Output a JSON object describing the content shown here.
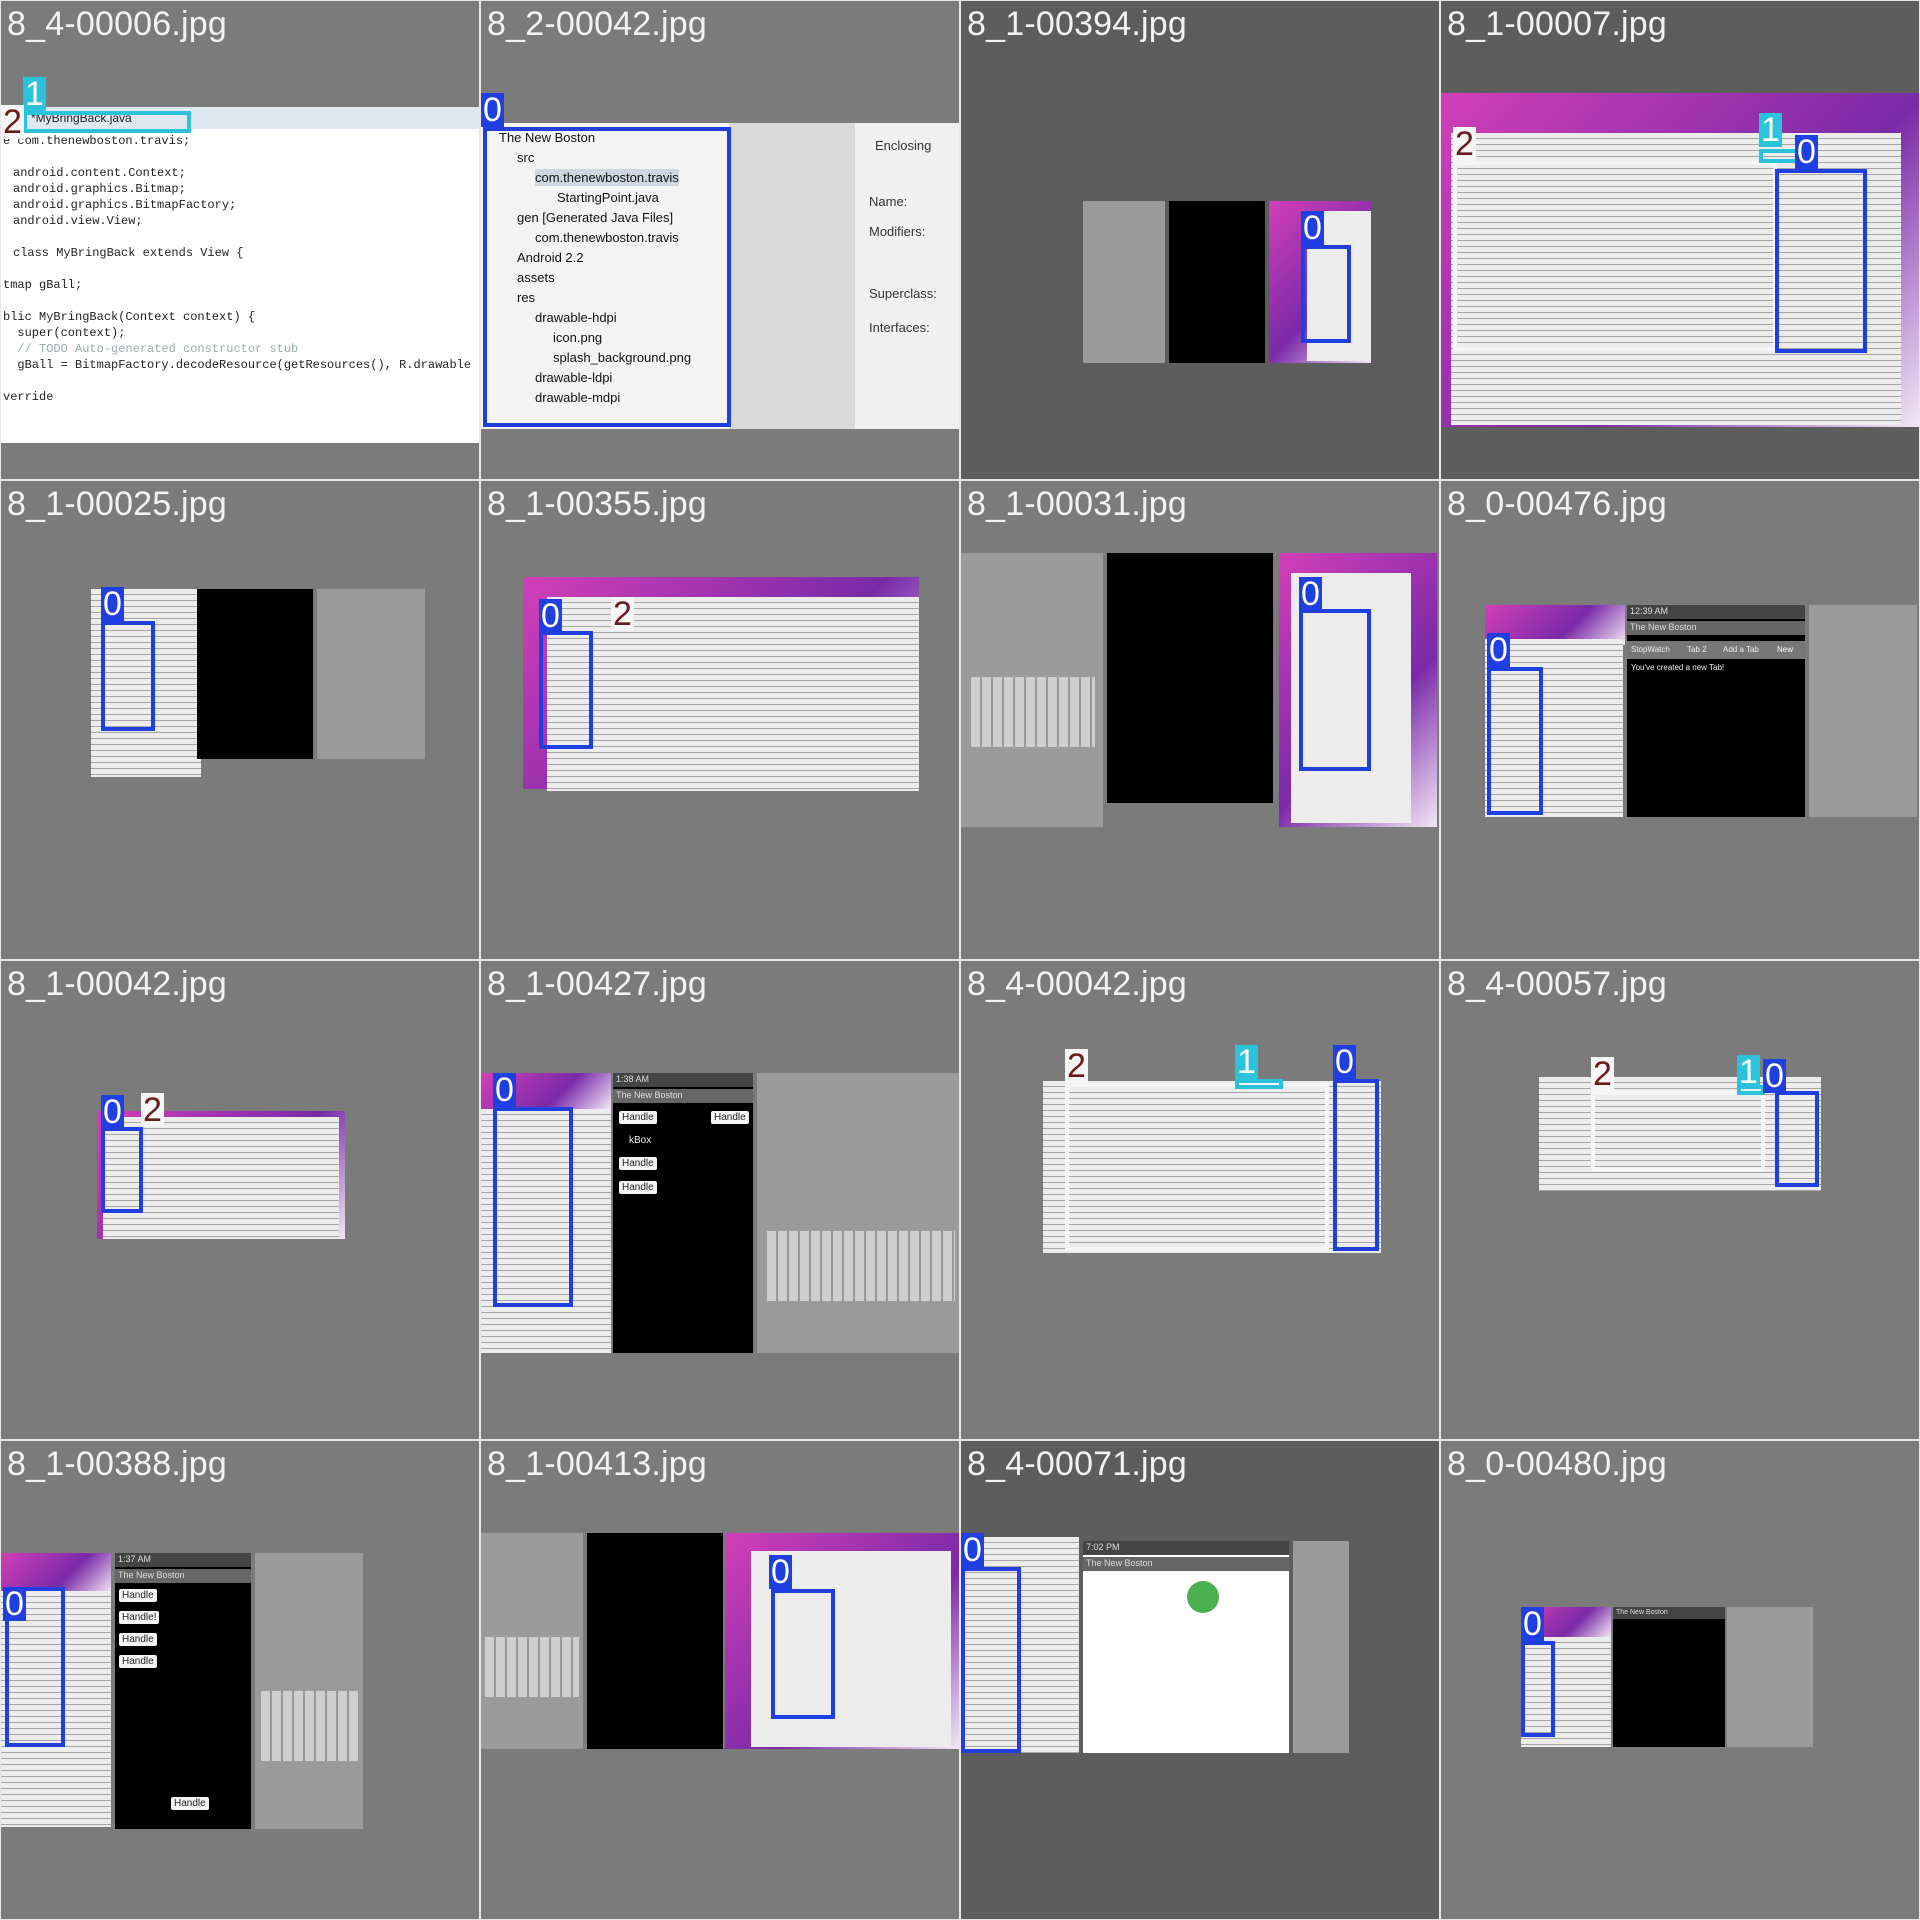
{
  "tiles": [
    {
      "filename": "8_4-00006.jpg",
      "labels": [
        "1",
        "2"
      ],
      "tab": "*MyBringBack.java",
      "code_lines": [
        "e com.thenewboston.travis;",
        "",
        "android.content.Context;",
        "android.graphics.Bitmap;",
        "android.graphics.BitmapFactory;",
        "android.view.View;",
        "",
        "class MyBringBack extends View {",
        "",
        "tmap gBall;",
        "",
        "blic MyBringBack(Context context) {",
        "  super(context);",
        "  // TODO Auto-generated constructor stub",
        "  gBall = BitmapFactory.decodeResource(getResources(), R.drawable",
        "",
        "verride"
      ]
    },
    {
      "filename": "8_2-00042.jpg",
      "labels": [
        "0"
      ],
      "tree_items": [
        "The New Boston",
        "src",
        "com.thenewboston.travis",
        "StartingPoint.java",
        "gen [Generated Java Files]",
        "com.thenewboston.travis",
        "Android 2.2",
        "assets",
        "res",
        "drawable-hdpi",
        "icon.png",
        "splash_background.png",
        "drawable-ldpi",
        "drawable-mdpi"
      ],
      "side_panel": {
        "enclosing": "Enclosing",
        "name": "Name:",
        "modifiers": "Modifiers:",
        "superclass": "Superclass:",
        "interfaces": "Interfaces:"
      }
    },
    {
      "filename": "8_1-00394.jpg",
      "labels": [
        "0"
      ]
    },
    {
      "filename": "8_1-00007.jpg",
      "labels": [
        "2",
        "1",
        "0"
      ]
    },
    {
      "filename": "8_1-00025.jpg",
      "labels": [
        "0"
      ]
    },
    {
      "filename": "8_1-00355.jpg",
      "labels": [
        "0",
        "2"
      ]
    },
    {
      "filename": "8_1-00031.jpg",
      "labels": [
        "0"
      ]
    },
    {
      "filename": "8_0-00476.jpg",
      "labels": [
        "0"
      ],
      "app_title": "The New Boston",
      "tabs": [
        "StopWatch",
        "Tab 2",
        "Add a Tab",
        "New"
      ],
      "message": "You've created a new Tab!",
      "clock": "12:39 AM"
    },
    {
      "filename": "8_1-00042.jpg",
      "labels": [
        "0",
        "2"
      ]
    },
    {
      "filename": "8_1-00427.jpg",
      "labels": [
        "0"
      ],
      "app_title": "The New Boston",
      "clock": "1:38 AM",
      "buttons": [
        "Handle",
        "Handle",
        "Handle",
        "Handle"
      ],
      "checkbox": "kBox"
    },
    {
      "filename": "8_4-00042.jpg",
      "labels": [
        "2",
        "1",
        "0"
      ]
    },
    {
      "filename": "8_4-00057.jpg",
      "labels": [
        "2",
        "1",
        "0"
      ]
    },
    {
      "filename": "8_1-00388.jpg",
      "labels": [
        "0"
      ],
      "app_title": "The New Boston",
      "clock": "1:37 AM",
      "buttons": [
        "Handle",
        "Handle!",
        "Handle",
        "Handle"
      ],
      "bottom_button": "Handle"
    },
    {
      "filename": "8_1-00413.jpg",
      "labels": [
        "0"
      ]
    },
    {
      "filename": "8_4-00071.jpg",
      "labels": [
        "0"
      ],
      "app_title": "The New Boston",
      "clock": "7:02 PM"
    },
    {
      "filename": "8_0-00480.jpg",
      "labels": [
        "0"
      ],
      "app_title": "The New Boston"
    }
  ],
  "colors": {
    "box_blue": "#1f3fe0",
    "box_cyan": "#2bc3dc",
    "box_white": "#f5f5f5",
    "label_dark_red": "#6a1b1b",
    "tile_bg": "#5d5d5d"
  }
}
